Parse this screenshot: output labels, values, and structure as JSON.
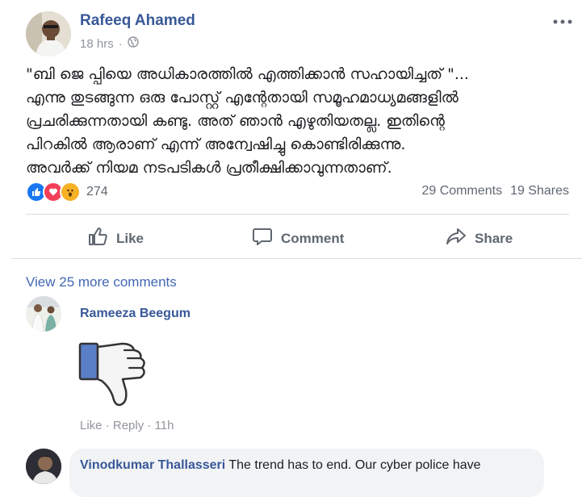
{
  "post": {
    "author": "Rafeeq Ahamed",
    "time": "18 hrs",
    "privacy_icon": "globe-icon",
    "text_lines": [
      "\"ബി ജെ പ്പിയെ അധികാരത്തിൽ എത്തിക്കാൻ സഹായിച്ചത് \"...",
      "എന്നു തുടങ്ങുന്ന ഒരു പോസ്റ്റ് എന്റേതായി സമൂഹമാധ്യമങ്ങളിൽ",
      "പ്രചരിക്കുന്നതായി കണ്ടു. അത് ഞാൻ എഴുതിയതല്ല. ഇതിന്റെ",
      "പിറകിൽ ആരാണ് എന്ന് അന്വേഷിച്ചു കൊണ്ടിരിക്കുന്നു.",
      "അവർക്ക് നിയമ നടപടികൾ പ്രതീക്ഷിക്കാവുന്നതാണ്."
    ],
    "reaction_count": "274",
    "comments_count": "29 Comments",
    "shares_count": "19 Shares"
  },
  "actions": {
    "like": "Like",
    "comment": "Comment",
    "share": "Share"
  },
  "comments": {
    "view_more": "View 25 more comments",
    "first": {
      "name": "Rameeza Beegum",
      "sticker": "thumbs-down-sticker",
      "like": "Like",
      "reply": "Reply",
      "sep": "·",
      "time": "11h"
    },
    "second": {
      "name": "Vinodkumar Thallasseri",
      "text": "The trend has to end. Our cyber police have"
    }
  },
  "colors": {
    "link_blue": "#385898",
    "accent_blue": "#4267b2",
    "gray_text": "#606770",
    "like_blue": "#1877f2",
    "love_red": "#f33e58",
    "wow_yellow": "#f7b125"
  }
}
